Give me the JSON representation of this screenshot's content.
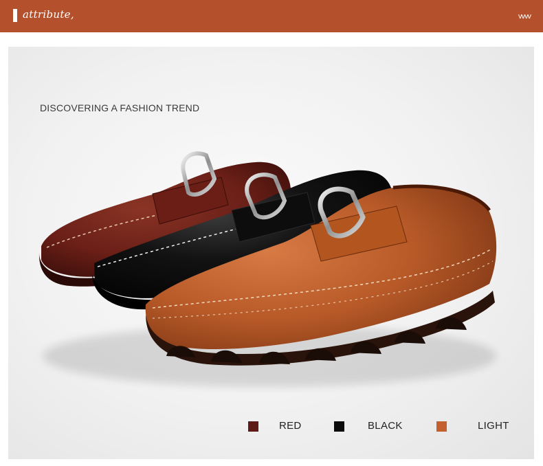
{
  "header": {
    "title": "attribute,",
    "chevrons": "vvvv",
    "color": "#b5502c"
  },
  "main": {
    "headline": "DISCOVERING A FASHION TREND",
    "image": "shoe-trio-image"
  },
  "colors": [
    {
      "label": "RED",
      "hex": "#5e1a15"
    },
    {
      "label": "BLACK",
      "hex": "#0b0b0b"
    },
    {
      "label": "LIGHT",
      "hex": "#c4602f"
    }
  ]
}
